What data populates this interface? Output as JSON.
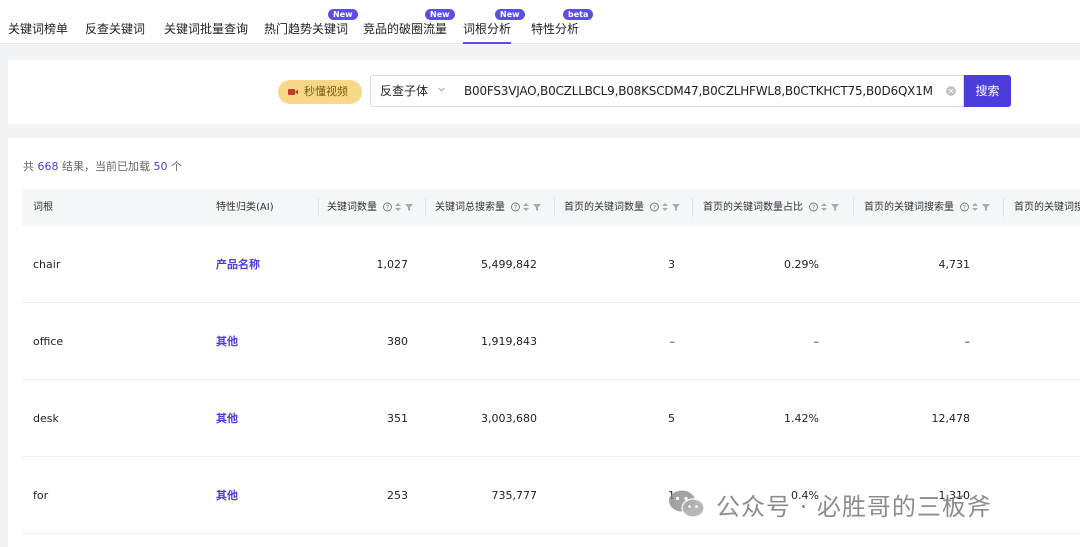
{
  "nav": {
    "tabs": [
      {
        "label": "关键词榜单",
        "badge": ""
      },
      {
        "label": "反查关键词",
        "badge": ""
      },
      {
        "label": "关键词批量查询",
        "badge": ""
      },
      {
        "label": "热门趋势关键词",
        "badge": "New"
      },
      {
        "label": "竞品的破圈流量",
        "badge": "New"
      },
      {
        "label": "词根分析",
        "badge": "New",
        "active": true
      },
      {
        "label": "特性分析",
        "badge": "beta"
      }
    ]
  },
  "search": {
    "video_label": "秒懂视频",
    "mode": "反查子体",
    "asins": "B00FS3VJAO,B0CZLLBCL9,B08KSCDM47,B0CZLHFWL8,B0CTKHCT75,B0D6QX1M",
    "button": "搜索"
  },
  "summary": {
    "prefix": "共",
    "total": "668",
    "middle": "结果，当前已加载",
    "loaded": "50",
    "suffix": "个"
  },
  "table": {
    "columns": [
      "词根",
      "特性归类(AI)",
      "关键词数量",
      "关键词总搜索量",
      "首页的关键词数量",
      "首页的关键词数量占比",
      "首页的关键词搜索量",
      "首页的关键词搜"
    ],
    "rows": [
      {
        "root": "chair",
        "category": "产品名称",
        "kw_count": "1,027",
        "total_search": "5,499,842",
        "home_kw_count": "3",
        "home_kw_ratio": "0.29%",
        "home_kw_search": "4,731"
      },
      {
        "root": "office",
        "category": "其他",
        "kw_count": "380",
        "total_search": "1,919,843",
        "home_kw_count": "–",
        "home_kw_ratio": "–",
        "home_kw_search": "–"
      },
      {
        "root": "desk",
        "category": "其他",
        "kw_count": "351",
        "total_search": "3,003,680",
        "home_kw_count": "5",
        "home_kw_ratio": "1.42%",
        "home_kw_search": "12,478"
      },
      {
        "root": "for",
        "category": "其他",
        "kw_count": "253",
        "total_search": "735,777",
        "home_kw_count": "1",
        "home_kw_ratio": "0.4%",
        "home_kw_search": "1,310"
      }
    ]
  },
  "watermark": {
    "text": "公众号 · 必胜哥的三板斧"
  },
  "colors": {
    "accent": "#4b3ddb",
    "video_btn": "#f7d886"
  }
}
